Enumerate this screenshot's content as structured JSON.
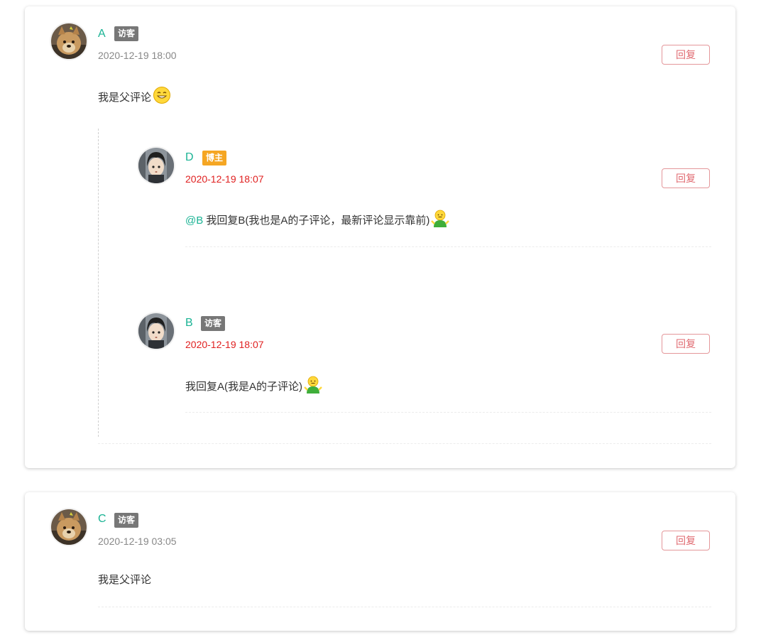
{
  "comments": [
    {
      "name": "A",
      "badge": "访客",
      "time": "2020-12-19 18:00",
      "reply_label": "回复",
      "content": "我是父评论",
      "emoji": "grinning-face",
      "replies": [
        {
          "name": "D",
          "badge": "博主",
          "time": "2020-12-19 18:07",
          "reply_label": "回复",
          "mention": "@B",
          "content": "我回复B(我也是A的子评论，最新评论显示靠前)",
          "emoji": "shrug-person"
        },
        {
          "name": "B",
          "badge": "访客",
          "time": "2020-12-19 18:07",
          "reply_label": "回复",
          "content": "我回复A(我是A的子评论)",
          "emoji": "shrug-person"
        }
      ]
    },
    {
      "name": "C",
      "badge": "访客",
      "time": "2020-12-19 03:05",
      "reply_label": "回复",
      "content": "我是父评论"
    }
  ],
  "colors": {
    "name": "#1ab394",
    "guest_badge": "#777777",
    "owner_badge": "#f5a623",
    "reply_time": "#e02020",
    "reply_button": "#e06a70"
  }
}
